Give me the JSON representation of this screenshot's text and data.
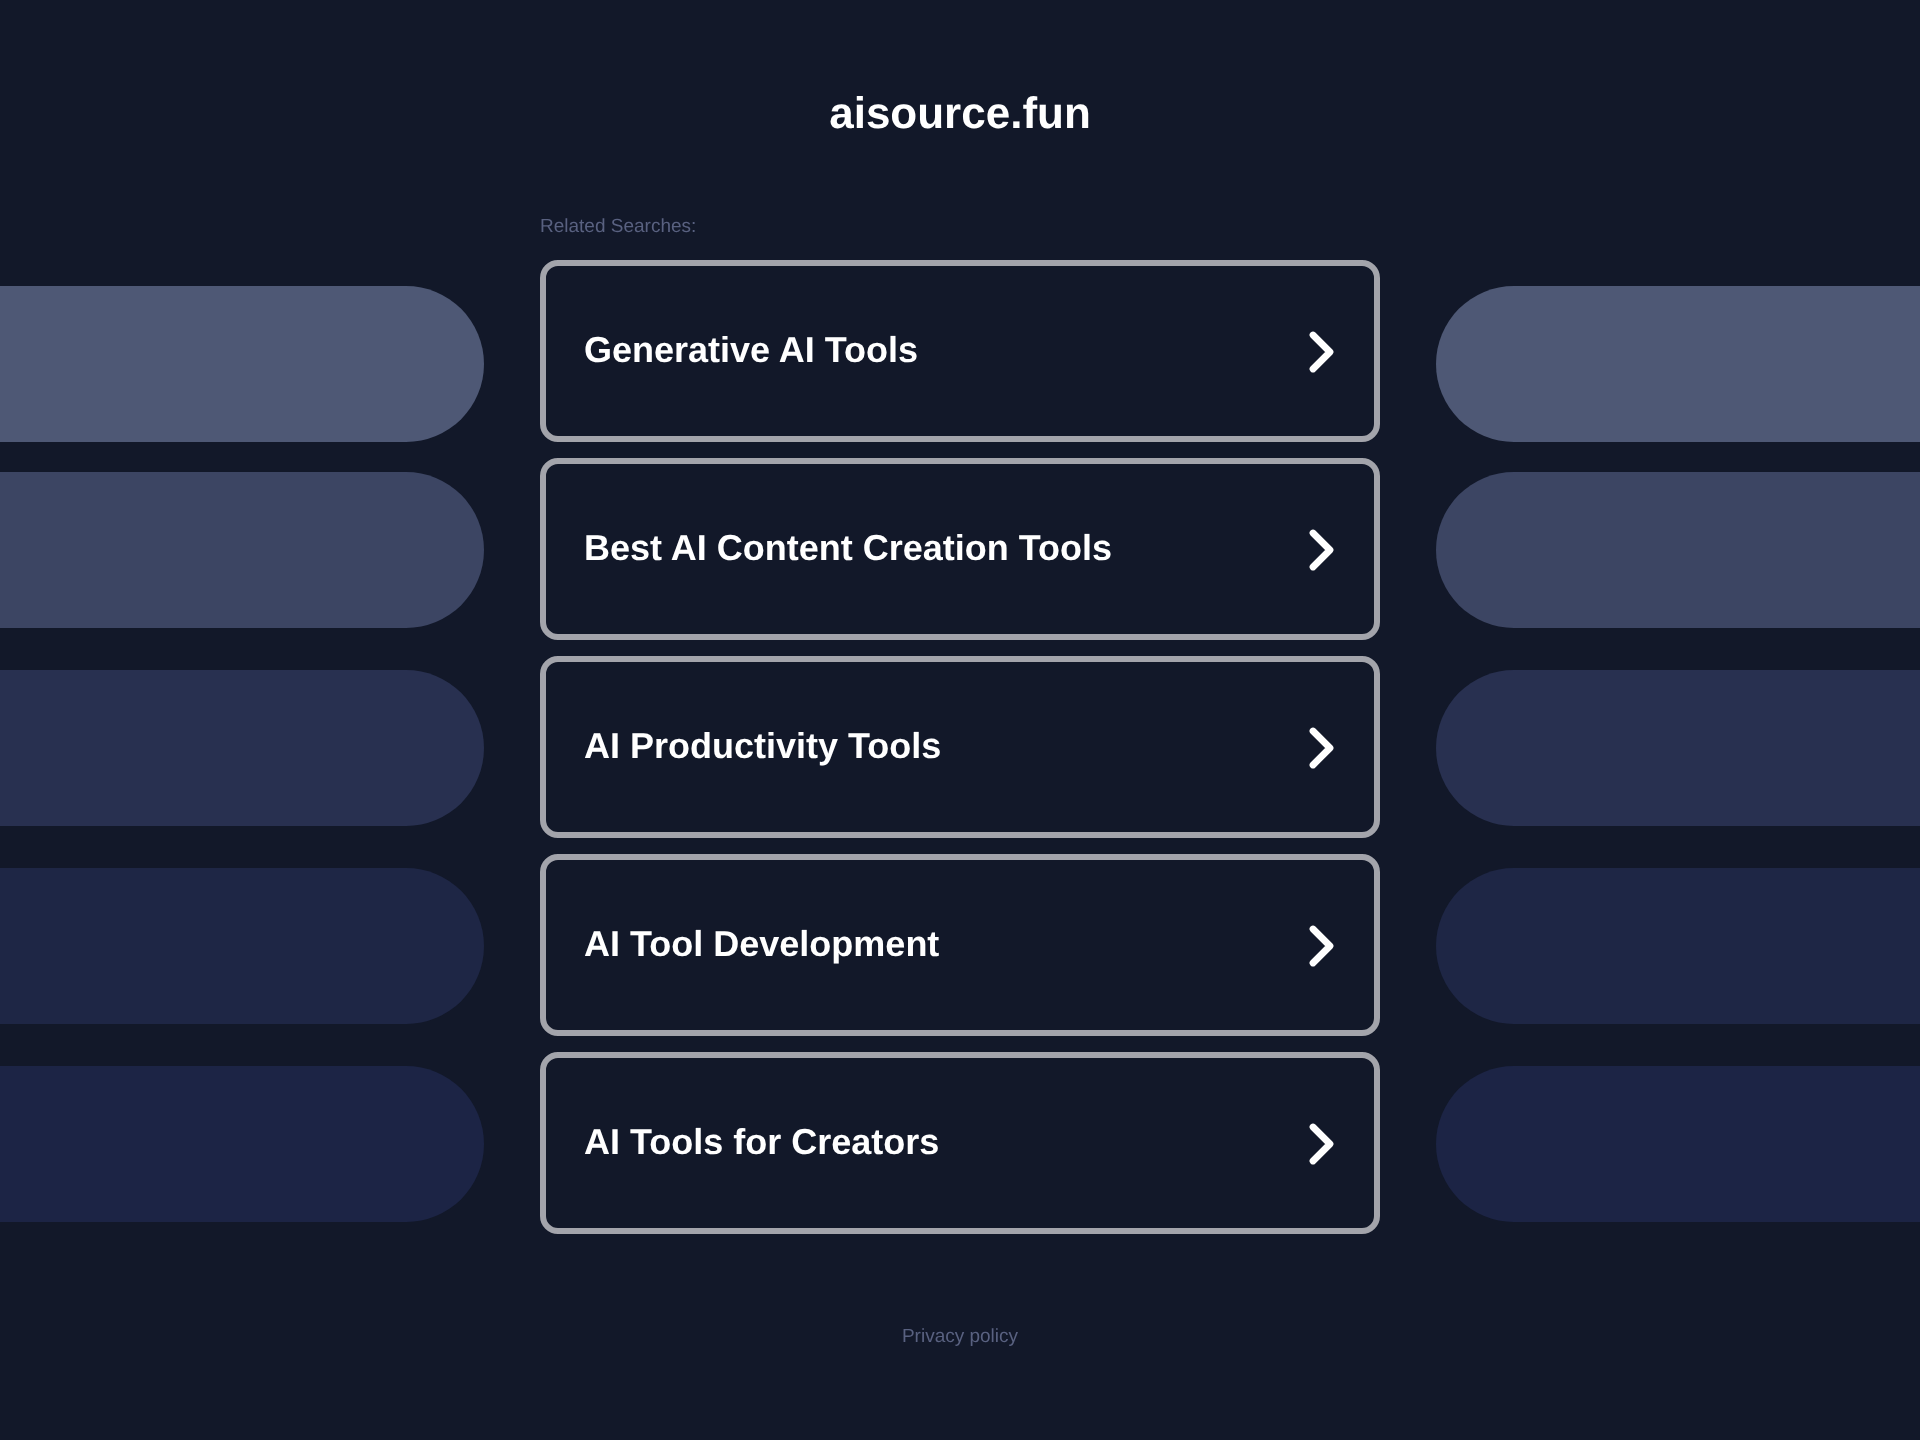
{
  "site_title": "aisource.fun",
  "related_searches": {
    "label": "Related Searches:",
    "items": [
      "Generative AI Tools",
      "Best AI Content Creation Tools",
      "AI Productivity Tools",
      "AI Tool Development",
      "AI Tools for Creators"
    ]
  },
  "footer": {
    "privacy_link": "Privacy policy"
  }
}
